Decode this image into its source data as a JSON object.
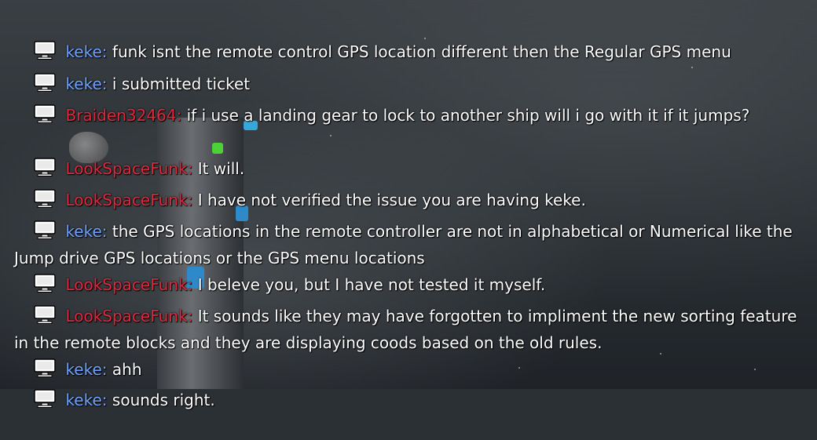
{
  "chat": {
    "messages": [
      {
        "user": "keke",
        "user_color": "#6fa2ff",
        "text": "funk isnt the remote control GPS location different then the Regular GPS menu"
      },
      {
        "user": "keke",
        "user_color": "#6fa2ff",
        "text": "i submitted ticket"
      },
      {
        "user": "Braiden32464",
        "user_color": "#e0273e",
        "text": "if i use a landing gear to lock to another ship will i go with it if it jumps?"
      },
      {
        "user": "LookSpaceFunk",
        "user_color": "#e0273e",
        "text": "It will."
      },
      {
        "user": "LookSpaceFunk",
        "user_color": "#e0273e",
        "text": "I have not verified the issue you are having keke."
      },
      {
        "user": "keke",
        "user_color": "#6fa2ff",
        "text": "the GPS locations in the remote controller are not in alphabetical or Numerical like the Jump drive GPS locations or the GPS menu locations"
      },
      {
        "user": "LookSpaceFunk",
        "user_color": "#e0273e",
        "text": "I beleve you, but I have not tested it myself."
      },
      {
        "user": "LookSpaceFunk",
        "user_color": "#e0273e",
        "text": "It sounds like they may have forgotten to impliment the new sorting feature in the remote blocks and they are displaying coods based on the old rules."
      },
      {
        "user": "keke",
        "user_color": "#6fa2ff",
        "text": "ahh"
      },
      {
        "user": "keke",
        "user_color": "#6fa2ff",
        "text": "sounds right."
      }
    ],
    "separator": ": "
  },
  "icons": {
    "message": "monitor-icon"
  }
}
